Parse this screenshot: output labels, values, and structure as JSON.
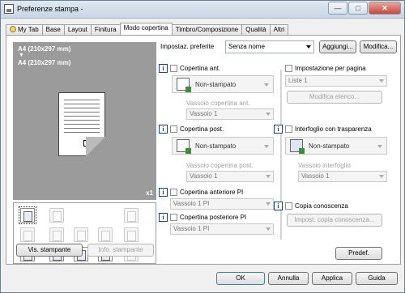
{
  "window": {
    "title": "Preferenze stampa -",
    "min": "—",
    "max": "□",
    "close": "✕"
  },
  "tabs": [
    {
      "label": "My Tab"
    },
    {
      "label": "Base"
    },
    {
      "label": "Layout"
    },
    {
      "label": "Finitura"
    },
    {
      "label": "Modo copertina"
    },
    {
      "label": "Timbro/Composizione"
    },
    {
      "label": "Qualità"
    },
    {
      "label": "Altri"
    }
  ],
  "preset": {
    "label": "Impostaz. preferite",
    "value": "Senza nome",
    "add_button": "Aggiungi...",
    "edit_button": "Modifica..."
  },
  "preview": {
    "line1": "A4 (210x297 mm)",
    "arrow": "▼",
    "line2": "A4 (210x297 mm)",
    "copies": "x1"
  },
  "left_buttons": {
    "printer_view": "Vis. stampante",
    "printer_info": "Info. stampante"
  },
  "front_cover": {
    "label": "Copertina ant.",
    "mode": "Non-stampato",
    "tray_label": "Vassoio copertina ant.",
    "tray": "Vassoio 1"
  },
  "back_cover": {
    "label": "Copertina post.",
    "mode": "Non-stampato",
    "tray_label": "Vassoio copertina post.",
    "tray": "Vassoio 1"
  },
  "front_pi": {
    "label": "Copertina anteriore PI",
    "tray": "Vassoio 1 PI"
  },
  "back_pi": {
    "label": "Copertina posteriore PI",
    "tray": "Vassoio 1 PI"
  },
  "per_page": {
    "label": "Impostazione per pagina",
    "list": "Liste 1",
    "edit_button": "Modifica elenco..."
  },
  "transparency": {
    "label": "Interfoglio con trasparenza",
    "mode": "Non-stampato",
    "tray_label": "Vassoio interfoglio",
    "tray": "Vassoio 1"
  },
  "carbon": {
    "label": "Copia conoscenza",
    "button": "Impost. copia conoscenza..."
  },
  "defaults_button": "Predef.",
  "footer": {
    "ok": "OK",
    "cancel": "Annulla",
    "apply": "Applica",
    "help": "Guida"
  },
  "icons": {
    "info": "i"
  }
}
